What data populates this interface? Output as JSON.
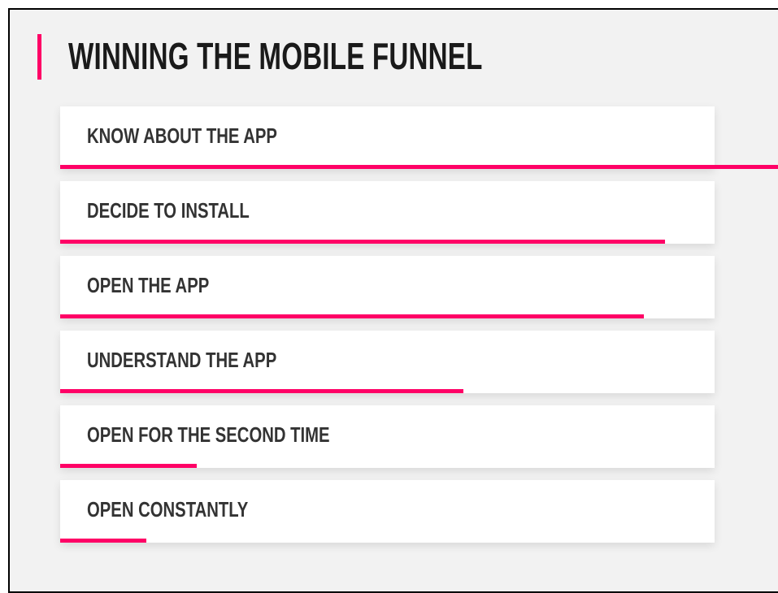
{
  "title": "WINNING THE MOBILE FUNNEL",
  "accent_color": "#ff0066",
  "funnel": {
    "steps": [
      {
        "label": "KNOW ABOUT THE APP",
        "progress": 1.0
      },
      {
        "label": "DECIDE TO INSTALL",
        "progress": 0.84
      },
      {
        "label": "OPEN THE APP",
        "progress": 0.81
      },
      {
        "label": "UNDERSTAND THE APP",
        "progress": 0.56
      },
      {
        "label": "OPEN FOR THE SECOND TIME",
        "progress": 0.19
      },
      {
        "label": "OPEN CONSTANTLY",
        "progress": 0.12
      }
    ]
  }
}
